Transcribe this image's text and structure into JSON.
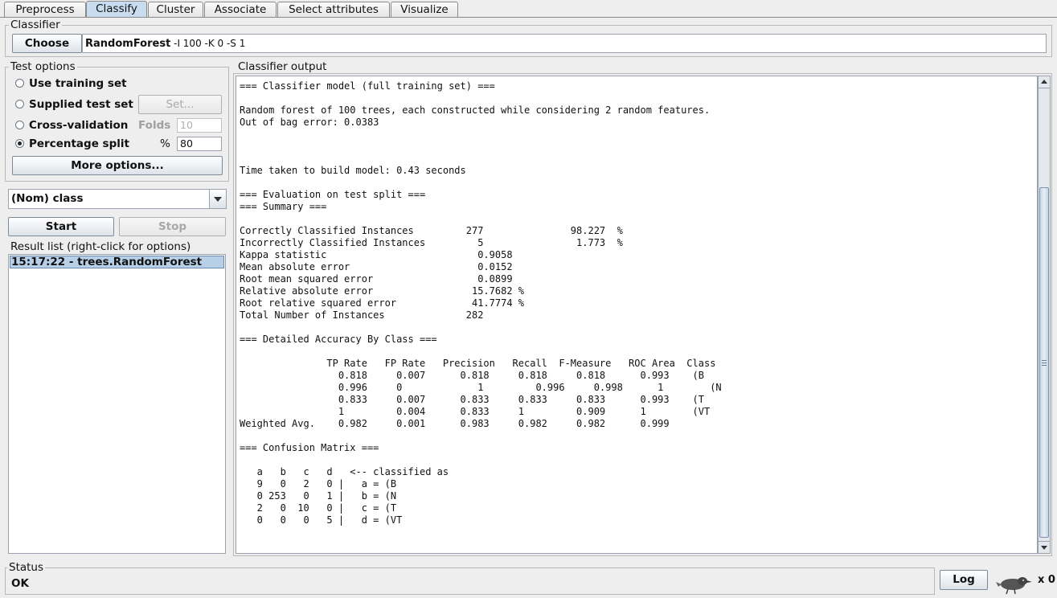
{
  "tabs": [
    {
      "label": "Preprocess",
      "active": false
    },
    {
      "label": "Classify",
      "active": true
    },
    {
      "label": "Cluster",
      "active": false
    },
    {
      "label": "Associate",
      "active": false
    },
    {
      "label": "Select attributes",
      "active": false
    },
    {
      "label": "Visualize",
      "active": false
    }
  ],
  "classifier": {
    "group_title": "Classifier",
    "choose_label": "Choose",
    "name": "RandomForest",
    "args": " -I 100 -K 0 -S 1"
  },
  "test_options": {
    "title": "Test options",
    "use_training": "Use training set",
    "supplied": "Supplied test set",
    "set_label": "Set...",
    "cross_validation": "Cross-validation",
    "folds_label": "Folds",
    "folds_value": "10",
    "percentage_split": "Percentage split",
    "percent_label": "%",
    "percent_value": "80",
    "selected": "percentage_split",
    "more_options": "More options..."
  },
  "class_select": {
    "value": "(Nom) class"
  },
  "run": {
    "start": "Start",
    "stop": "Stop"
  },
  "result_list": {
    "title": "Result list (right-click for options)",
    "items": [
      "15:17:22 - trees.RandomForest"
    ]
  },
  "output": {
    "title": "Classifier output",
    "lines": [
      "=== Classifier model (full training set) ===",
      "",
      "Random forest of 100 trees, each constructed while considering 2 random features.",
      "Out of bag error: 0.0383",
      "",
      "",
      "",
      "Time taken to build model: 0.43 seconds",
      "",
      "=== Evaluation on test split ===",
      "=== Summary ===",
      "",
      "Correctly Classified Instances         277               98.227  %",
      "Incorrectly Classified Instances         5                1.773  %",
      "Kappa statistic                          0.9058",
      "Mean absolute error                      0.0152",
      "Root mean squared error                  0.0899",
      "Relative absolute error                 15.7682 %",
      "Root relative squared error             41.7774 %",
      "Total Number of Instances              282     ",
      "",
      "=== Detailed Accuracy By Class ===",
      "",
      "               TP Rate   FP Rate   Precision   Recall  F-Measure   ROC Area  Class",
      "                 0.818     0.007      0.818     0.818     0.818      0.993    (B",
      "                 0.996     0             1         0.996     0.998      1        (N",
      "                 0.833     0.007      0.833     0.833     0.833      0.993    (T",
      "                 1         0.004      0.833     1         0.909      1        (VT",
      "Weighted Avg.    0.982     0.001      0.983     0.982     0.982      0.999",
      "",
      "=== Confusion Matrix ===",
      "",
      "   a   b   c   d   <-- classified as",
      "   9   0   2   0 |   a = (B",
      "   0 253   0   1 |   b = (N",
      "   2   0  10   0 |   c = (T",
      "   0   0   0   5 |   d = (VT"
    ]
  },
  "status": {
    "title": "Status",
    "text": "OK",
    "log_label": "Log",
    "x_count": "x 0"
  }
}
